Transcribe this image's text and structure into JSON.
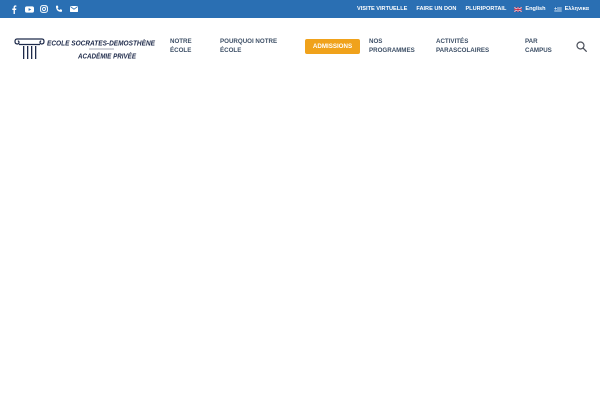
{
  "social": {
    "icons": [
      "facebook-icon",
      "youtube-icon",
      "instagram-icon",
      "phone-icon",
      "mail-icon"
    ]
  },
  "topbar": {
    "links": [
      "VISITE VIRTUELLE",
      "FAIRE UN DON",
      "PLURIPORTAIL"
    ],
    "lang_english": "English",
    "lang_greek": "Ελληνικα",
    "background_color": "#2a6fb3"
  },
  "logo": {
    "text_line1": "ECOLE SOCRATES-DEMOSTHÈNE",
    "text_line2": "ACADÉMIE PRIVÉE"
  },
  "nav": {
    "notre_ecole": [
      "NOTRE",
      "ÉCOLE"
    ],
    "pourquoi": [
      "POURQUOI NOTRE",
      "ÉCOLE"
    ],
    "admissions": "ADMISSIONS",
    "programmes": [
      "NOS",
      "PROGRAMMES"
    ],
    "activites": [
      "ACTIVITÉS",
      "PARASCOLAIRES"
    ],
    "campus": [
      "PAR",
      "CAMPUS"
    ],
    "accent_color": "#f0a21b",
    "text_color": "#3d4f66"
  }
}
